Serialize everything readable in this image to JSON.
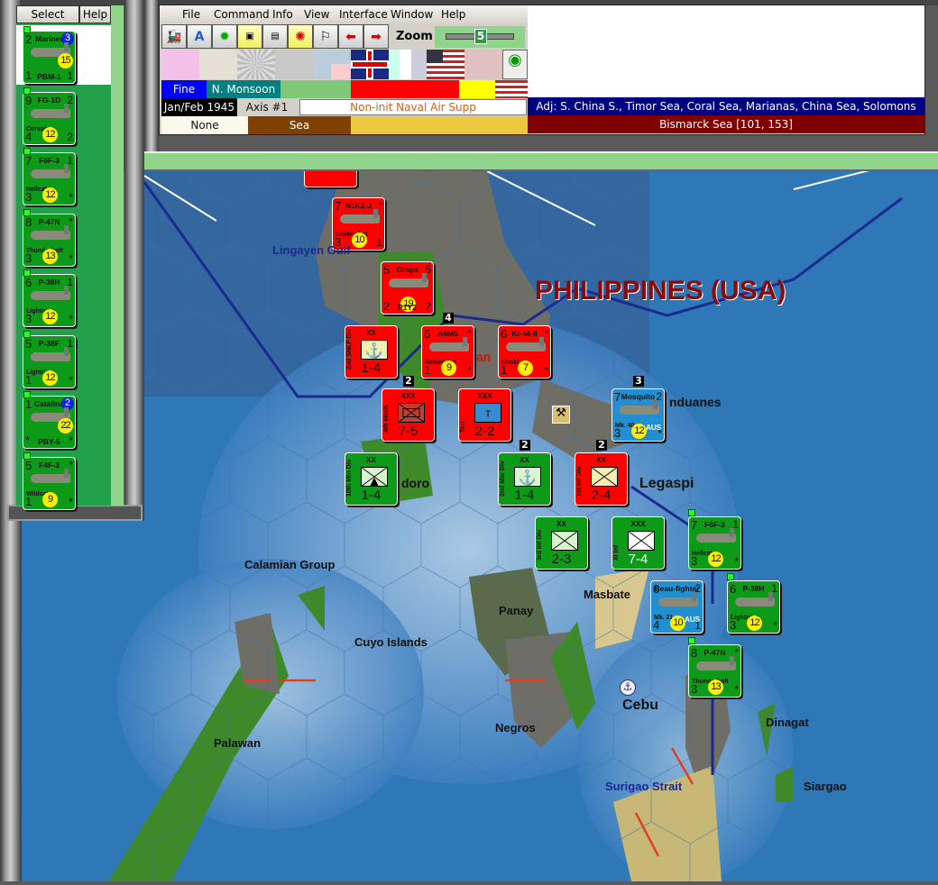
{
  "menu": {
    "items": [
      "File",
      "Command",
      "Info",
      "View",
      "Interface",
      "Window",
      "Help"
    ]
  },
  "toolbar": {
    "zoom_label": "Zoom",
    "zoom_value": "5",
    "icons": [
      "train-icon",
      "air-icon",
      "gear-unit-icon",
      "corps-toggle-icon",
      "division-toggle-icon",
      "weather-icon",
      "flag-icon",
      "prev-arrow-icon",
      "next-arrow-icon"
    ],
    "letter_a": "A"
  },
  "status": {
    "weather": "Fine",
    "weather_zone": "N. Monsoon",
    "date": "Jan/Feb 1945",
    "impulse": "Axis #1",
    "phase": "Non-init Naval Air Supp",
    "adjacent": "Adj: S. China S., Timor Sea, Coral Sea, Marianas, China Sea, Solomons",
    "terrain_left": "None",
    "terrain_mid": "Sea",
    "sea_area": "Bismarck Sea [101, 153]"
  },
  "colors": {
    "weather": "#0000ff",
    "zone": "#008080",
    "adj": "#000080",
    "sea_area": "#800000",
    "axis_red": "#ff0000",
    "allied_green": "#0c9a18",
    "aus_blue": "#2290d0"
  },
  "left_panel": {
    "select": "Select",
    "help": "Help",
    "units": [
      {
        "tl": "2",
        "name": "Mariner",
        "tr": "3",
        "circ": "15",
        "bl": "1",
        "bot": "PBM-1",
        "br": "1",
        "big": true
      },
      {
        "tl": "9",
        "name": "FG-1D",
        "tr": "2",
        "sub": "Corsair",
        "bl": "4",
        "circ": "12",
        "br": "2"
      },
      {
        "tl": "7",
        "name": "F6F-3",
        "tr": "1",
        "sub": "Hellcat",
        "bl": "3",
        "circ": "12",
        "br": "*"
      },
      {
        "tl": "8",
        "name": "P-47N",
        "tr": "*",
        "sub": "Thunderbolt",
        "bl": "3",
        "circ": "13",
        "br": "*"
      },
      {
        "tl": "6",
        "name": "P-38H",
        "tr": "1",
        "sub": "Lightning",
        "bl": "3",
        "circ": "12",
        "br": "*"
      },
      {
        "tl": "5",
        "name": "P-38F",
        "tr": "1",
        "sub": "Lightning",
        "bl": "1",
        "circ": "12",
        "br": "*"
      },
      {
        "tl": "1",
        "name": "Catalina",
        "tr": "2",
        "circ": "22",
        "bl": "*",
        "bot": "PBY-5",
        "br": "*",
        "big": true
      },
      {
        "tl": "5",
        "name": "F4F-3",
        "tr": "*",
        "sub": "Wildcat",
        "bl": "1",
        "circ": "9",
        "br": "*"
      }
    ]
  },
  "map": {
    "title": "PHILIPPINES (USA)",
    "labels": [
      "Lingayen Gulf",
      "nduanes",
      "doro",
      "Legaspi",
      "Calamian Group",
      "Masbate",
      "Panay",
      "Cuyo Islands",
      "Cebu",
      "Negros",
      "Dinagat",
      "Palawan",
      "Surigao Strait",
      "Siargao",
      "an"
    ],
    "air_units": [
      {
        "c": "red",
        "tl": "7",
        "name": "N1K2-J",
        "tr": "*",
        "sub": "Shiden-kai",
        "bl": "3",
        "circ": "10",
        "br": "1"
      },
      {
        "c": "red",
        "tl": "5",
        "name": "Ginga",
        "tr": "5",
        "circ": "19",
        "bl": "2",
        "bot": "P1Y2",
        "br": "2"
      },
      {
        "c": "red",
        "tl": "6",
        "name": "A6M5",
        "tr": "*",
        "sub": "Reisen-kai",
        "bl": "1",
        "circ": "9",
        "br": "*",
        "badge": "4"
      },
      {
        "c": "red",
        "tl": "6",
        "name": "Ki-44-II",
        "tr": "*",
        "sub": "Shoki",
        "bl": "1",
        "circ": "7",
        "br": "*"
      },
      {
        "c": "blue",
        "tl": "7",
        "name": "Mosquito",
        "tr": "2",
        "sub": "Mk. 40",
        "nat": "AUS",
        "bl": "3",
        "circ": "12",
        "br": "*",
        "badge": "3"
      },
      {
        "c": "green",
        "tl": "7",
        "name": "F6F-3",
        "tr": "1",
        "sub": "Hellcat",
        "bl": "3",
        "circ": "12",
        "br": "*"
      },
      {
        "c": "blue",
        "tl": "6",
        "name": "Beau-fighter",
        "tr": "2",
        "sub": "Mk. 21",
        "nat": "AUS",
        "bl": "4",
        "circ": "10",
        "br": "1"
      },
      {
        "c": "green",
        "tl": "6",
        "name": "P-38H",
        "tr": "1",
        "sub": "Lightning",
        "bl": "3",
        "circ": "12",
        "br": "*"
      },
      {
        "c": "green",
        "tl": "8",
        "name": "P-47N",
        "tr": "*",
        "sub": "Thunderbolt",
        "bl": "3",
        "circ": "13",
        "br": "*"
      }
    ],
    "land_units": [
      {
        "c": "red",
        "size": "XX",
        "str": "1-4",
        "side": "2nd SNLF Div",
        "type": "marine"
      },
      {
        "c": "red",
        "size": "XXX",
        "str": "7-5",
        "side": "4th Mech",
        "type": "mech",
        "badge": "2"
      },
      {
        "c": "red",
        "size": "XXX",
        "str": "2-2",
        "side": "Terr",
        "type": "terr"
      },
      {
        "c": "green",
        "size": "XX",
        "str": "1-4",
        "side": "10th Mtn Div",
        "type": "mountain"
      },
      {
        "c": "green",
        "size": "XX",
        "str": "1-4",
        "side": "2nd Mar Div",
        "type": "marine",
        "badge": "2"
      },
      {
        "c": "red",
        "size": "XX",
        "str": "2-4",
        "side": "1st Inf Div",
        "type": "inf",
        "badge": "2"
      },
      {
        "c": "green",
        "size": "XX",
        "str": "2-3",
        "side": "3rd Inf Div",
        "type": "inf"
      },
      {
        "c": "green",
        "size": "XXX",
        "str": "7-4",
        "side": "XI Inf",
        "type": "inf"
      }
    ]
  }
}
